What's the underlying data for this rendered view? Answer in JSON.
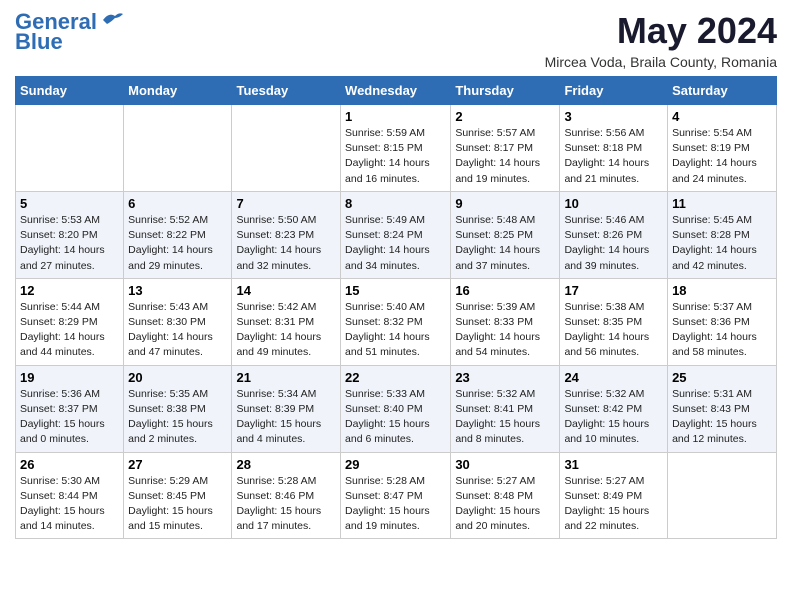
{
  "logo": {
    "line1": "General",
    "line2": "Blue"
  },
  "title": "May 2024",
  "subtitle": "Mircea Voda, Braila County, Romania",
  "headers": [
    "Sunday",
    "Monday",
    "Tuesday",
    "Wednesday",
    "Thursday",
    "Friday",
    "Saturday"
  ],
  "weeks": [
    [
      {
        "num": "",
        "info": ""
      },
      {
        "num": "",
        "info": ""
      },
      {
        "num": "",
        "info": ""
      },
      {
        "num": "1",
        "info": "Sunrise: 5:59 AM\nSunset: 8:15 PM\nDaylight: 14 hours and 16 minutes."
      },
      {
        "num": "2",
        "info": "Sunrise: 5:57 AM\nSunset: 8:17 PM\nDaylight: 14 hours and 19 minutes."
      },
      {
        "num": "3",
        "info": "Sunrise: 5:56 AM\nSunset: 8:18 PM\nDaylight: 14 hours and 21 minutes."
      },
      {
        "num": "4",
        "info": "Sunrise: 5:54 AM\nSunset: 8:19 PM\nDaylight: 14 hours and 24 minutes."
      }
    ],
    [
      {
        "num": "5",
        "info": "Sunrise: 5:53 AM\nSunset: 8:20 PM\nDaylight: 14 hours and 27 minutes."
      },
      {
        "num": "6",
        "info": "Sunrise: 5:52 AM\nSunset: 8:22 PM\nDaylight: 14 hours and 29 minutes."
      },
      {
        "num": "7",
        "info": "Sunrise: 5:50 AM\nSunset: 8:23 PM\nDaylight: 14 hours and 32 minutes."
      },
      {
        "num": "8",
        "info": "Sunrise: 5:49 AM\nSunset: 8:24 PM\nDaylight: 14 hours and 34 minutes."
      },
      {
        "num": "9",
        "info": "Sunrise: 5:48 AM\nSunset: 8:25 PM\nDaylight: 14 hours and 37 minutes."
      },
      {
        "num": "10",
        "info": "Sunrise: 5:46 AM\nSunset: 8:26 PM\nDaylight: 14 hours and 39 minutes."
      },
      {
        "num": "11",
        "info": "Sunrise: 5:45 AM\nSunset: 8:28 PM\nDaylight: 14 hours and 42 minutes."
      }
    ],
    [
      {
        "num": "12",
        "info": "Sunrise: 5:44 AM\nSunset: 8:29 PM\nDaylight: 14 hours and 44 minutes."
      },
      {
        "num": "13",
        "info": "Sunrise: 5:43 AM\nSunset: 8:30 PM\nDaylight: 14 hours and 47 minutes."
      },
      {
        "num": "14",
        "info": "Sunrise: 5:42 AM\nSunset: 8:31 PM\nDaylight: 14 hours and 49 minutes."
      },
      {
        "num": "15",
        "info": "Sunrise: 5:40 AM\nSunset: 8:32 PM\nDaylight: 14 hours and 51 minutes."
      },
      {
        "num": "16",
        "info": "Sunrise: 5:39 AM\nSunset: 8:33 PM\nDaylight: 14 hours and 54 minutes."
      },
      {
        "num": "17",
        "info": "Sunrise: 5:38 AM\nSunset: 8:35 PM\nDaylight: 14 hours and 56 minutes."
      },
      {
        "num": "18",
        "info": "Sunrise: 5:37 AM\nSunset: 8:36 PM\nDaylight: 14 hours and 58 minutes."
      }
    ],
    [
      {
        "num": "19",
        "info": "Sunrise: 5:36 AM\nSunset: 8:37 PM\nDaylight: 15 hours and 0 minutes."
      },
      {
        "num": "20",
        "info": "Sunrise: 5:35 AM\nSunset: 8:38 PM\nDaylight: 15 hours and 2 minutes."
      },
      {
        "num": "21",
        "info": "Sunrise: 5:34 AM\nSunset: 8:39 PM\nDaylight: 15 hours and 4 minutes."
      },
      {
        "num": "22",
        "info": "Sunrise: 5:33 AM\nSunset: 8:40 PM\nDaylight: 15 hours and 6 minutes."
      },
      {
        "num": "23",
        "info": "Sunrise: 5:32 AM\nSunset: 8:41 PM\nDaylight: 15 hours and 8 minutes."
      },
      {
        "num": "24",
        "info": "Sunrise: 5:32 AM\nSunset: 8:42 PM\nDaylight: 15 hours and 10 minutes."
      },
      {
        "num": "25",
        "info": "Sunrise: 5:31 AM\nSunset: 8:43 PM\nDaylight: 15 hours and 12 minutes."
      }
    ],
    [
      {
        "num": "26",
        "info": "Sunrise: 5:30 AM\nSunset: 8:44 PM\nDaylight: 15 hours and 14 minutes."
      },
      {
        "num": "27",
        "info": "Sunrise: 5:29 AM\nSunset: 8:45 PM\nDaylight: 15 hours and 15 minutes."
      },
      {
        "num": "28",
        "info": "Sunrise: 5:28 AM\nSunset: 8:46 PM\nDaylight: 15 hours and 17 minutes."
      },
      {
        "num": "29",
        "info": "Sunrise: 5:28 AM\nSunset: 8:47 PM\nDaylight: 15 hours and 19 minutes."
      },
      {
        "num": "30",
        "info": "Sunrise: 5:27 AM\nSunset: 8:48 PM\nDaylight: 15 hours and 20 minutes."
      },
      {
        "num": "31",
        "info": "Sunrise: 5:27 AM\nSunset: 8:49 PM\nDaylight: 15 hours and 22 minutes."
      },
      {
        "num": "",
        "info": ""
      }
    ]
  ]
}
